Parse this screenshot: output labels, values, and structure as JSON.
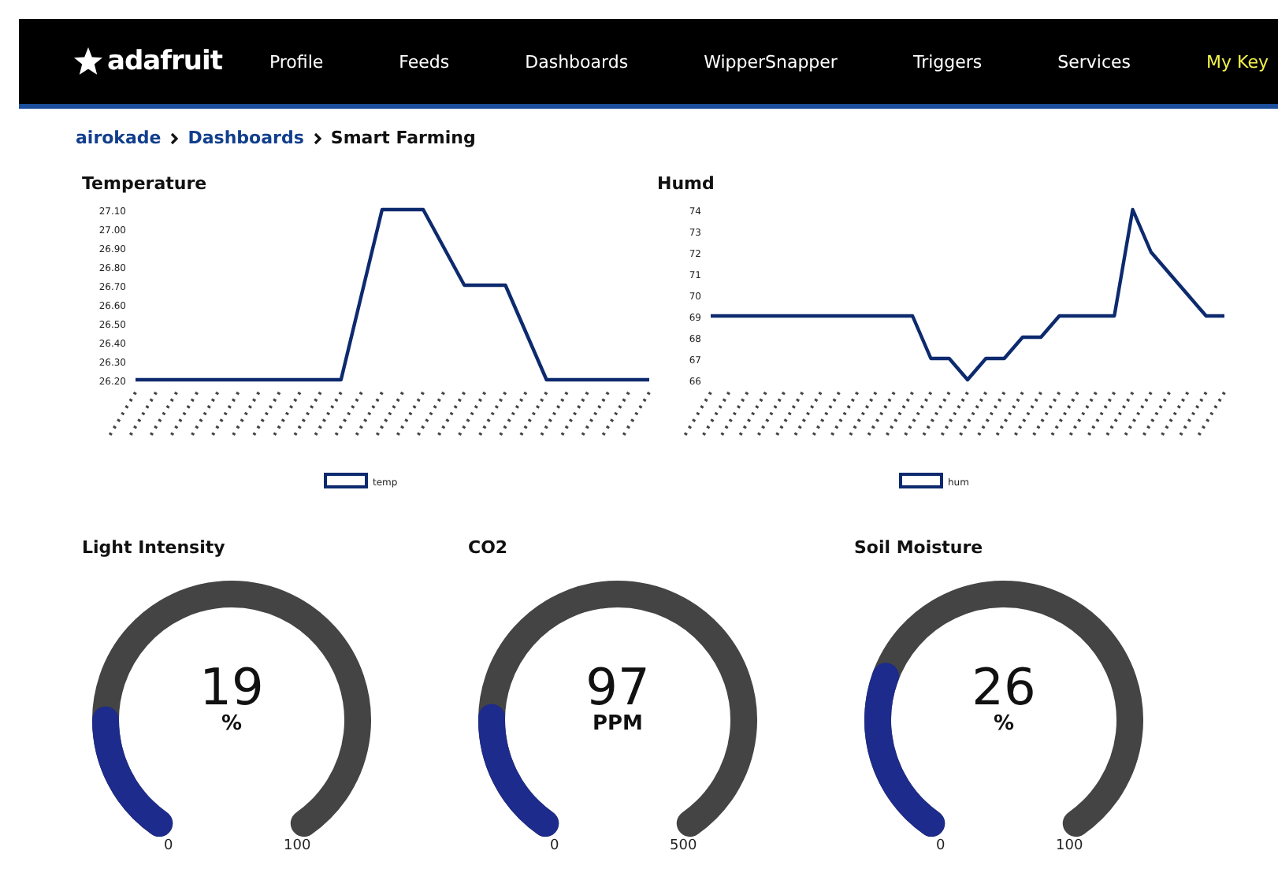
{
  "nav": {
    "logo": "adafruit",
    "items": [
      {
        "label": "Profile",
        "highlight": false
      },
      {
        "label": "Feeds",
        "highlight": false
      },
      {
        "label": "Dashboards",
        "highlight": false
      },
      {
        "label": "WipperSnapper",
        "highlight": false
      },
      {
        "label": "Triggers",
        "highlight": false
      },
      {
        "label": "Services",
        "highlight": false
      },
      {
        "label": "My Key",
        "highlight": true
      }
    ]
  },
  "breadcrumb": [
    "airokade",
    "Dashboards",
    "Smart Farming"
  ],
  "charts": [
    {
      "chart_data": {
        "type": "line",
        "title": "Temperature",
        "ylim": [
          26.2,
          27.1
        ],
        "yticks": [
          {
            "value": 26.2,
            "label": "26.20"
          },
          {
            "value": 26.3,
            "label": "26.30"
          },
          {
            "value": 26.4,
            "label": "26.40"
          },
          {
            "value": 26.5,
            "label": "26.50"
          },
          {
            "value": 26.6,
            "label": "26.60"
          },
          {
            "value": 26.7,
            "label": "26.70"
          },
          {
            "value": 26.8,
            "label": "26.80"
          },
          {
            "value": 26.9,
            "label": "26.90"
          },
          {
            "value": 27.0,
            "label": "27.00"
          },
          {
            "value": 27.1,
            "label": "27.10"
          }
        ],
        "series": [
          {
            "name": "temp",
            "color": "#0d2a6e",
            "values": [
              26.2,
              26.2,
              26.2,
              26.2,
              26.2,
              26.2,
              26.2,
              26.2,
              26.2,
              26.2,
              26.2,
              26.65,
              27.1,
              27.1,
              27.1,
              26.9,
              26.7,
              26.7,
              26.7,
              26.45,
              26.2,
              26.2,
              26.2,
              26.2,
              26.2,
              26.2
            ]
          }
        ]
      }
    },
    {
      "chart_data": {
        "type": "line",
        "title": "Humd",
        "ylim": [
          66,
          74
        ],
        "yticks": [
          66,
          67,
          68,
          69,
          70,
          71,
          72,
          73,
          74
        ],
        "series": [
          {
            "name": "hum",
            "color": "#0d2a6e",
            "values": [
              69,
              69,
              69,
              69,
              69,
              69,
              69,
              69,
              69,
              69,
              69,
              69,
              67,
              67,
              66,
              67,
              67,
              68,
              68,
              69,
              69,
              69,
              69,
              74,
              72,
              71,
              70,
              69,
              69
            ]
          }
        ]
      }
    }
  ],
  "gauges": [
    {
      "title": "Light Intensity",
      "value": "19",
      "unit": "%",
      "min": "0",
      "max": "100"
    },
    {
      "title": "CO2",
      "value": "97",
      "unit": "PPM",
      "min": "0",
      "max": "500"
    },
    {
      "title": "Soil Moisture",
      "value": "26",
      "unit": "%",
      "min": "0",
      "max": "100"
    }
  ]
}
